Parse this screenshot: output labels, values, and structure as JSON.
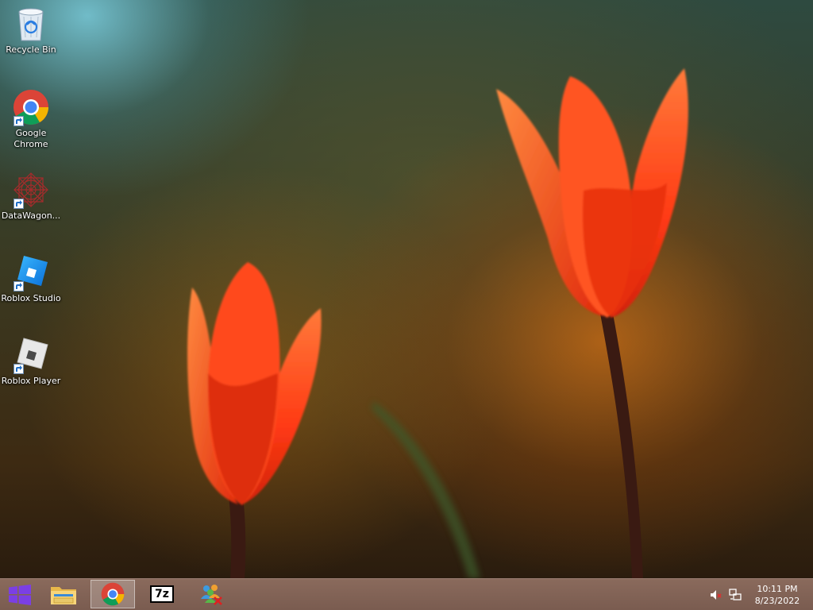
{
  "desktop": {
    "icons": [
      {
        "label": "Recycle Bin",
        "icon": "recycle-bin-icon",
        "shortcut": false
      },
      {
        "label": "Google Chrome",
        "icon": "chrome-icon",
        "shortcut": true
      },
      {
        "label": "DataWagon...",
        "icon": "datawagon-icon",
        "shortcut": true
      },
      {
        "label": "Roblox Studio",
        "icon": "roblox-studio-icon",
        "shortcut": true
      },
      {
        "label": "Roblox Player",
        "icon": "roblox-player-icon",
        "shortcut": true
      }
    ]
  },
  "taskbar": {
    "start_icon": "windows-logo-icon",
    "pinned": [
      {
        "icon": "file-explorer-icon",
        "active": false
      },
      {
        "icon": "chrome-icon",
        "active": true
      },
      {
        "icon": "7zip-icon",
        "active": false,
        "text": "7z"
      },
      {
        "icon": "network-people-icon",
        "active": false
      }
    ],
    "tray": {
      "volume_icon": "volume-muted-icon",
      "network_icon": "network-icon",
      "time": "10:11 PM",
      "date": "8/23/2022"
    }
  },
  "colors": {
    "taskbar": "#7a5c50",
    "windows_logo": "#7b3fe4",
    "tulip": "#ff4a1a"
  }
}
